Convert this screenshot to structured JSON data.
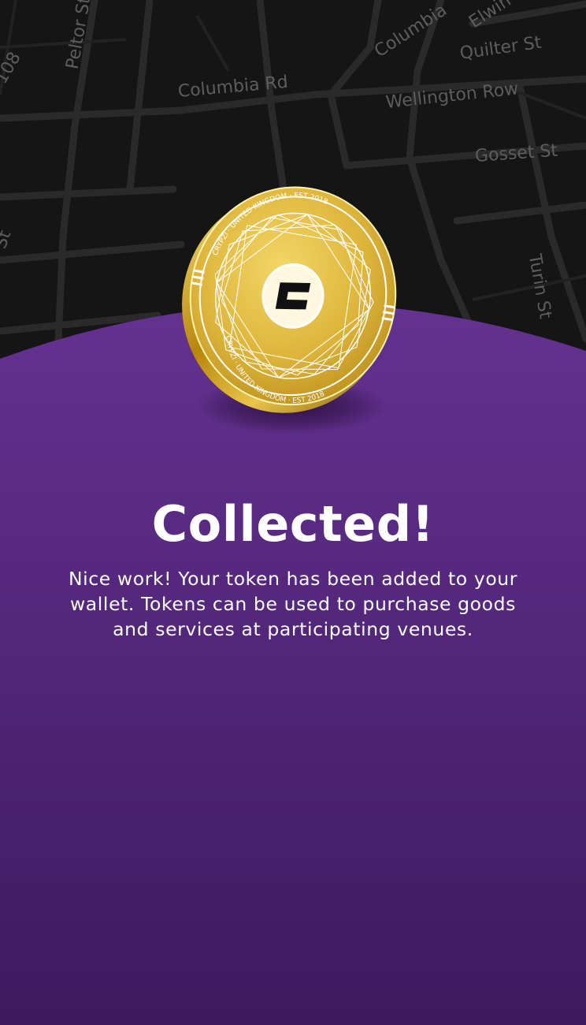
{
  "map": {
    "streets": [
      "Peltor St",
      "Columbia Rd",
      "Columbia",
      "Elwin",
      "Quilter St",
      "Wellington Row",
      "Gosset St",
      "Turin St",
      "108",
      "St"
    ]
  },
  "coin": {
    "ring_text_top": "CRYPZI · UNITED KINGDOM · EST 2018",
    "ring_text_bottom": "CRYPZI · UNITED KINGDOM · EST 2018",
    "logo_icon": "crypzi-logo-icon"
  },
  "content": {
    "title": "Collected!",
    "message": "Nice work! Your token has been added to your wallet. Tokens can be used to purchase goods and services at participating venues."
  },
  "colors": {
    "map_background": "#151515",
    "map_label": "#5d5d5d",
    "panel_top": "#62318c",
    "panel_bottom": "#3f1961",
    "coin_gold": "#e8c23a",
    "text": "#ffffff"
  }
}
